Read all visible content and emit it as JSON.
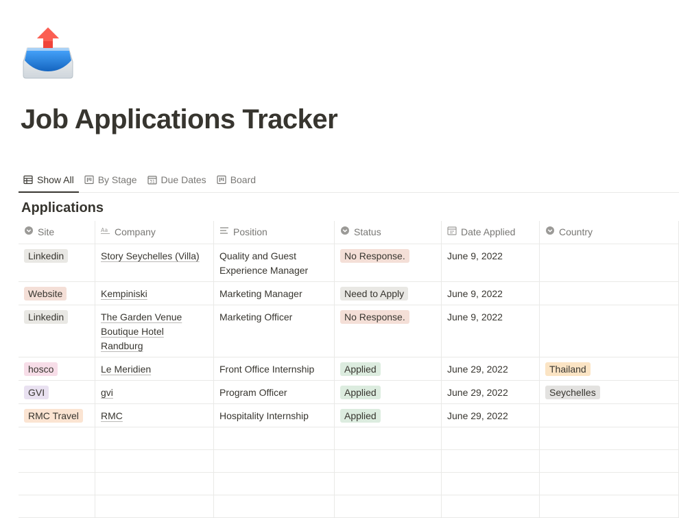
{
  "page": {
    "icon": "outbox-tray-icon",
    "title": "Job Applications Tracker"
  },
  "tabs": [
    {
      "label": "Show All",
      "icon": "table-icon",
      "active": true
    },
    {
      "label": "By Stage",
      "icon": "board-icon",
      "active": false
    },
    {
      "label": "Due Dates",
      "icon": "calendar-icon",
      "active": false
    },
    {
      "label": "Board",
      "icon": "board-icon",
      "active": false
    }
  ],
  "database": {
    "title": "Applications",
    "columns": [
      {
        "label": "Site",
        "icon": "select-icon"
      },
      {
        "label": "Company",
        "icon": "text-icon"
      },
      {
        "label": "Position",
        "icon": "lines-icon"
      },
      {
        "label": "Status",
        "icon": "select-icon"
      },
      {
        "label": "Date Applied",
        "icon": "calendar-icon"
      },
      {
        "label": "Country",
        "icon": "select-icon"
      }
    ],
    "rows": [
      {
        "site": {
          "text": "Linkedin",
          "bg": "#e9e8e4"
        },
        "company": "Story Seychelles (Villa)",
        "position": "Quality and Guest Experience Manager",
        "status": {
          "text": "No Response.",
          "bg": "#f4dfd7"
        },
        "date": "June 9, 2022",
        "country": null
      },
      {
        "site": {
          "text": "Website",
          "bg": "#f4dfd7"
        },
        "company": "Kempiniski",
        "position": "Marketing Manager",
        "status": {
          "text": "Need to Apply",
          "bg": "#e9e8e4"
        },
        "date": "June 9, 2022",
        "country": null
      },
      {
        "site": {
          "text": "Linkedin",
          "bg": "#e9e8e4"
        },
        "company": "The Garden Venue Boutique Hotel Randburg",
        "position": "Marketing Officer",
        "status": {
          "text": "No Response.",
          "bg": "#f4dfd7"
        },
        "date": "June 9, 2022",
        "country": null
      },
      {
        "site": {
          "text": "hosco",
          "bg": "#f7dde8"
        },
        "company": "Le Meridien",
        "position": "Front Office Internship",
        "status": {
          "text": "Applied",
          "bg": "#dcecdf"
        },
        "date": "June 29, 2022",
        "country": {
          "text": "Thailand",
          "bg": "#fbe4c4"
        }
      },
      {
        "site": {
          "text": "GVI",
          "bg": "#e9e1f1"
        },
        "company": "gvi",
        "position": "Program Officer",
        "status": {
          "text": "Applied",
          "bg": "#dcecdf"
        },
        "date": "June 29, 2022",
        "country": {
          "text": "Seychelles",
          "bg": "#e3e2e0"
        }
      },
      {
        "site": {
          "text": "RMC Travel",
          "bg": "#fbe4d2"
        },
        "company": "RMC",
        "position": "Hospitality Internship",
        "status": {
          "text": "Applied",
          "bg": "#dcecdf"
        },
        "date": "June 29, 2022",
        "country": null
      }
    ],
    "empty_row_count": 4
  }
}
